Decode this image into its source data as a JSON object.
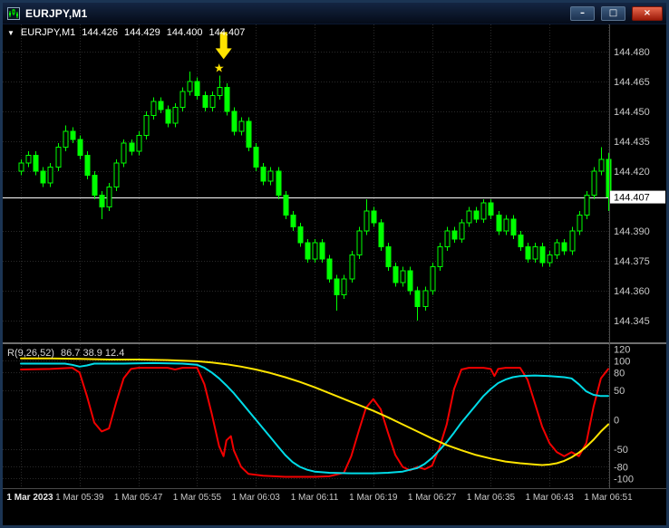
{
  "window": {
    "title": "EURJPY,M1",
    "controls": {
      "minimize": "–",
      "maximize": "□",
      "close": "×"
    }
  },
  "quote_header": {
    "dropdown_glyph": "▼",
    "symbol": "EURJPY,M1",
    "open": "144.426",
    "high": "144.429",
    "low": "144.400",
    "close": "144.407"
  },
  "indicator_header": {
    "label": "R(9,26,52)",
    "values": "86.7 38.9 12.4"
  },
  "colors": {
    "background": "#000000",
    "grid": "#2a2a2a",
    "bull": "#000000",
    "bear": "#00ff00",
    "candle_outline": "#00ff00",
    "bid_line": "#ffffff",
    "axis_text": "#c8c8c8",
    "marker": "#ffe400",
    "osc_red": "#f20000",
    "osc_cyan": "#00dce8",
    "osc_yellow": "#ffe400"
  },
  "chart_data": {
    "type": "candlestick",
    "symbol": "EURJPY",
    "timeframe": "M1",
    "start_time": "1 Mar 2023 05:31",
    "interval_minutes": 1,
    "price_axis_labels": [
      144.48,
      144.465,
      144.45,
      144.435,
      144.42,
      144.39,
      144.375,
      144.36,
      144.345
    ],
    "current_price": 144.407,
    "time_axis_labels": [
      "1 Mar 2023",
      "1 Mar 05:39",
      "1 Mar 05:47",
      "1 Mar 05:55",
      "1 Mar 06:03",
      "1 Mar 06:11",
      "1 Mar 06:19",
      "1 Mar 06:27",
      "1 Mar 06:35",
      "1 Mar 06:43",
      "1 Mar 06:51"
    ],
    "label_every_n_candles": 8,
    "marker": {
      "type": "sell-signal-arrow-with-star",
      "candle_index": 27,
      "star_glyph": "★"
    },
    "ohlc": [
      [
        144.42,
        144.426,
        144.418,
        144.424
      ],
      [
        144.424,
        144.43,
        144.422,
        144.428
      ],
      [
        144.428,
        144.43,
        144.418,
        144.42
      ],
      [
        144.42,
        144.422,
        144.412,
        144.414
      ],
      [
        144.414,
        144.424,
        144.412,
        144.422
      ],
      [
        144.422,
        144.434,
        144.42,
        144.432
      ],
      [
        144.432,
        144.443,
        144.43,
        144.44
      ],
      [
        144.44,
        144.442,
        144.434,
        144.436
      ],
      [
        144.436,
        144.438,
        144.426,
        144.428
      ],
      [
        144.428,
        144.43,
        144.416,
        144.418
      ],
      [
        144.418,
        144.42,
        144.406,
        144.408
      ],
      [
        144.408,
        144.41,
        144.396,
        144.402
      ],
      [
        144.402,
        144.414,
        144.4,
        144.412
      ],
      [
        144.412,
        144.426,
        144.41,
        144.424
      ],
      [
        144.424,
        144.436,
        144.422,
        144.434
      ],
      [
        144.434,
        144.436,
        144.428,
        144.43
      ],
      [
        144.43,
        144.44,
        144.428,
        144.438
      ],
      [
        144.438,
        144.45,
        144.436,
        144.448
      ],
      [
        144.448,
        144.457,
        144.446,
        144.455
      ],
      [
        144.455,
        144.457,
        144.449,
        144.451
      ],
      [
        144.451,
        144.453,
        144.442,
        144.444
      ],
      [
        144.444,
        144.454,
        144.442,
        144.452
      ],
      [
        144.452,
        144.462,
        144.45,
        144.46
      ],
      [
        144.46,
        144.47,
        144.458,
        144.465
      ],
      [
        144.465,
        144.467,
        144.456,
        144.458
      ],
      [
        144.458,
        144.46,
        144.45,
        144.452
      ],
      [
        144.452,
        144.46,
        144.45,
        144.458
      ],
      [
        144.458,
        144.468,
        144.456,
        144.462
      ],
      [
        144.462,
        144.464,
        144.448,
        144.45
      ],
      [
        144.45,
        144.452,
        144.438,
        144.44
      ],
      [
        144.44,
        144.447,
        144.438,
        144.445
      ],
      [
        144.445,
        144.447,
        144.43,
        144.432
      ],
      [
        144.432,
        144.434,
        144.42,
        144.422
      ],
      [
        144.422,
        144.424,
        144.413,
        144.415
      ],
      [
        144.415,
        144.422,
        144.413,
        144.42
      ],
      [
        144.42,
        144.422,
        144.406,
        144.408
      ],
      [
        144.408,
        144.41,
        144.396,
        144.398
      ],
      [
        144.398,
        144.4,
        144.39,
        144.392
      ],
      [
        144.392,
        144.394,
        144.382,
        144.384
      ],
      [
        144.384,
        144.386,
        144.374,
        144.376
      ],
      [
        144.376,
        144.386,
        144.374,
        144.384
      ],
      [
        144.384,
        144.386,
        144.374,
        144.376
      ],
      [
        144.376,
        144.378,
        144.364,
        144.366
      ],
      [
        144.366,
        144.368,
        144.35,
        144.358
      ],
      [
        144.358,
        144.368,
        144.356,
        144.366
      ],
      [
        144.366,
        144.38,
        144.364,
        144.378
      ],
      [
        144.378,
        144.392,
        144.376,
        144.39
      ],
      [
        144.39,
        144.406,
        144.388,
        144.4
      ],
      [
        144.4,
        144.402,
        144.392,
        144.394
      ],
      [
        144.394,
        144.396,
        144.38,
        144.382
      ],
      [
        144.382,
        144.384,
        144.37,
        144.372
      ],
      [
        144.372,
        144.374,
        144.362,
        144.364
      ],
      [
        144.364,
        144.372,
        144.362,
        144.37
      ],
      [
        144.37,
        144.372,
        144.358,
        144.36
      ],
      [
        144.36,
        144.362,
        144.345,
        144.352
      ],
      [
        144.352,
        144.362,
        144.35,
        144.36
      ],
      [
        144.36,
        144.374,
        144.358,
        144.372
      ],
      [
        144.372,
        144.384,
        144.37,
        144.382
      ],
      [
        144.382,
        144.392,
        144.38,
        144.39
      ],
      [
        144.39,
        144.392,
        144.384,
        144.386
      ],
      [
        144.386,
        144.396,
        144.384,
        144.394
      ],
      [
        144.394,
        144.402,
        144.392,
        144.4
      ],
      [
        144.4,
        144.402,
        144.394,
        144.396
      ],
      [
        144.396,
        144.406,
        144.394,
        144.404
      ],
      [
        144.404,
        144.406,
        144.396,
        144.398
      ],
      [
        144.398,
        144.4,
        144.388,
        144.39
      ],
      [
        144.39,
        144.398,
        144.388,
        144.396
      ],
      [
        144.396,
        144.398,
        144.386,
        144.388
      ],
      [
        144.388,
        144.39,
        144.38,
        144.382
      ],
      [
        144.382,
        144.384,
        144.374,
        144.376
      ],
      [
        144.376,
        144.384,
        144.374,
        144.382
      ],
      [
        144.382,
        144.384,
        144.372,
        144.374
      ],
      [
        144.374,
        144.38,
        144.372,
        144.378
      ],
      [
        144.378,
        144.386,
        144.376,
        144.384
      ],
      [
        144.384,
        144.386,
        144.378,
        144.38
      ],
      [
        144.38,
        144.392,
        144.378,
        144.39
      ],
      [
        144.39,
        144.4,
        144.388,
        144.398
      ],
      [
        144.398,
        144.41,
        144.396,
        144.408
      ],
      [
        144.408,
        144.422,
        144.406,
        144.42
      ],
      [
        144.42,
        144.432,
        144.418,
        144.426
      ],
      [
        144.426,
        144.429,
        144.4,
        144.407
      ]
    ],
    "oscillator": {
      "label": "R(9,26,52)",
      "current_values": [
        86.7,
        38.9,
        12.4
      ],
      "scale_ticks": [
        120,
        100,
        80,
        50,
        0,
        -50,
        -80,
        -100
      ],
      "level_lines": [
        100,
        80,
        50,
        0,
        -50,
        -80,
        -100
      ],
      "series": [
        {
          "name": "red",
          "color_key": "osc_red",
          "points": [
            [
              0,
              85
            ],
            [
              4,
              86
            ],
            [
              7,
              88
            ],
            [
              8,
              80
            ],
            [
              9,
              40
            ],
            [
              10,
              -5
            ],
            [
              11,
              -20
            ],
            [
              12,
              -15
            ],
            [
              13,
              30
            ],
            [
              14,
              70
            ],
            [
              15,
              86
            ],
            [
              16,
              88
            ],
            [
              20,
              88
            ],
            [
              21,
              85
            ],
            [
              22,
              88
            ],
            [
              24,
              88
            ],
            [
              25,
              60
            ],
            [
              26,
              10
            ],
            [
              27,
              -45
            ],
            [
              27.6,
              -62
            ],
            [
              28,
              -35
            ],
            [
              28.6,
              -28
            ],
            [
              29,
              -52
            ],
            [
              30,
              -80
            ],
            [
              31,
              -92
            ],
            [
              33,
              -95
            ],
            [
              36,
              -97
            ],
            [
              40,
              -97
            ],
            [
              42,
              -96
            ],
            [
              44,
              -90
            ],
            [
              45,
              -62
            ],
            [
              46,
              -20
            ],
            [
              47,
              20
            ],
            [
              48,
              35
            ],
            [
              49,
              18
            ],
            [
              50,
              -22
            ],
            [
              51,
              -60
            ],
            [
              52,
              -80
            ],
            [
              53,
              -86
            ],
            [
              54,
              -80
            ],
            [
              55,
              -84
            ],
            [
              56,
              -78
            ],
            [
              57,
              -48
            ],
            [
              58,
              -8
            ],
            [
              59,
              52
            ],
            [
              60,
              85
            ],
            [
              61,
              88
            ],
            [
              63,
              88
            ],
            [
              64,
              86
            ],
            [
              64.5,
              74
            ],
            [
              65,
              86
            ],
            [
              66,
              88
            ],
            [
              68,
              88
            ],
            [
              69,
              68
            ],
            [
              70,
              28
            ],
            [
              71,
              -12
            ],
            [
              72,
              -40
            ],
            [
              73,
              -55
            ],
            [
              74,
              -62
            ],
            [
              75,
              -55
            ],
            [
              76,
              -62
            ],
            [
              77,
              -40
            ],
            [
              78,
              22
            ],
            [
              79,
              70
            ],
            [
              80,
              86
            ]
          ]
        },
        {
          "name": "cyan",
          "color_key": "osc_cyan",
          "points": [
            [
              0,
              95
            ],
            [
              6,
              95
            ],
            [
              7,
              93
            ],
            [
              8,
              90
            ],
            [
              9,
              92
            ],
            [
              10,
              95
            ],
            [
              14,
              95
            ],
            [
              18,
              96
            ],
            [
              22,
              95
            ],
            [
              24,
              93
            ],
            [
              25,
              88
            ],
            [
              26,
              80
            ],
            [
              27,
              70
            ],
            [
              28,
              58
            ],
            [
              29,
              45
            ],
            [
              30,
              30
            ],
            [
              31,
              15
            ],
            [
              32,
              0
            ],
            [
              33,
              -15
            ],
            [
              34,
              -30
            ],
            [
              35,
              -45
            ],
            [
              36,
              -60
            ],
            [
              37,
              -72
            ],
            [
              38,
              -80
            ],
            [
              39,
              -85
            ],
            [
              40,
              -88
            ],
            [
              42,
              -90
            ],
            [
              45,
              -91
            ],
            [
              48,
              -91
            ],
            [
              50,
              -90
            ],
            [
              52,
              -88
            ],
            [
              53,
              -85
            ],
            [
              54,
              -82
            ],
            [
              55,
              -75
            ],
            [
              56,
              -65
            ],
            [
              57,
              -52
            ],
            [
              58,
              -38
            ],
            [
              59,
              -22
            ],
            [
              60,
              -5
            ],
            [
              61,
              10
            ],
            [
              62,
              25
            ],
            [
              63,
              40
            ],
            [
              64,
              52
            ],
            [
              65,
              62
            ],
            [
              66,
              68
            ],
            [
              67,
              72
            ],
            [
              68,
              74
            ],
            [
              70,
              75
            ],
            [
              72,
              74
            ],
            [
              74,
              72
            ],
            [
              75,
              70
            ],
            [
              76,
              60
            ],
            [
              77,
              48
            ],
            [
              78,
              42
            ],
            [
              79,
              40
            ],
            [
              80,
              40
            ]
          ]
        },
        {
          "name": "yellow",
          "color_key": "osc_yellow",
          "points": [
            [
              0,
              104
            ],
            [
              4,
              104
            ],
            [
              8,
              103
            ],
            [
              12,
              102
            ],
            [
              16,
              102
            ],
            [
              20,
              101
            ],
            [
              22,
              100
            ],
            [
              24,
              99
            ],
            [
              26,
              97
            ],
            [
              28,
              94
            ],
            [
              30,
              90
            ],
            [
              32,
              85
            ],
            [
              34,
              79
            ],
            [
              36,
              72
            ],
            [
              38,
              64
            ],
            [
              40,
              55
            ],
            [
              42,
              45
            ],
            [
              44,
              35
            ],
            [
              46,
              25
            ],
            [
              48,
              15
            ],
            [
              50,
              4
            ],
            [
              52,
              -8
            ],
            [
              54,
              -20
            ],
            [
              56,
              -32
            ],
            [
              58,
              -43
            ],
            [
              60,
              -52
            ],
            [
              62,
              -60
            ],
            [
              64,
              -66
            ],
            [
              66,
              -71
            ],
            [
              68,
              -74
            ],
            [
              70,
              -76
            ],
            [
              71,
              -77
            ],
            [
              72,
              -76
            ],
            [
              73,
              -74
            ],
            [
              74,
              -70
            ],
            [
              75,
              -64
            ],
            [
              76,
              -56
            ],
            [
              77,
              -46
            ],
            [
              78,
              -34
            ],
            [
              79,
              -20
            ],
            [
              80,
              -8
            ]
          ]
        }
      ]
    }
  }
}
